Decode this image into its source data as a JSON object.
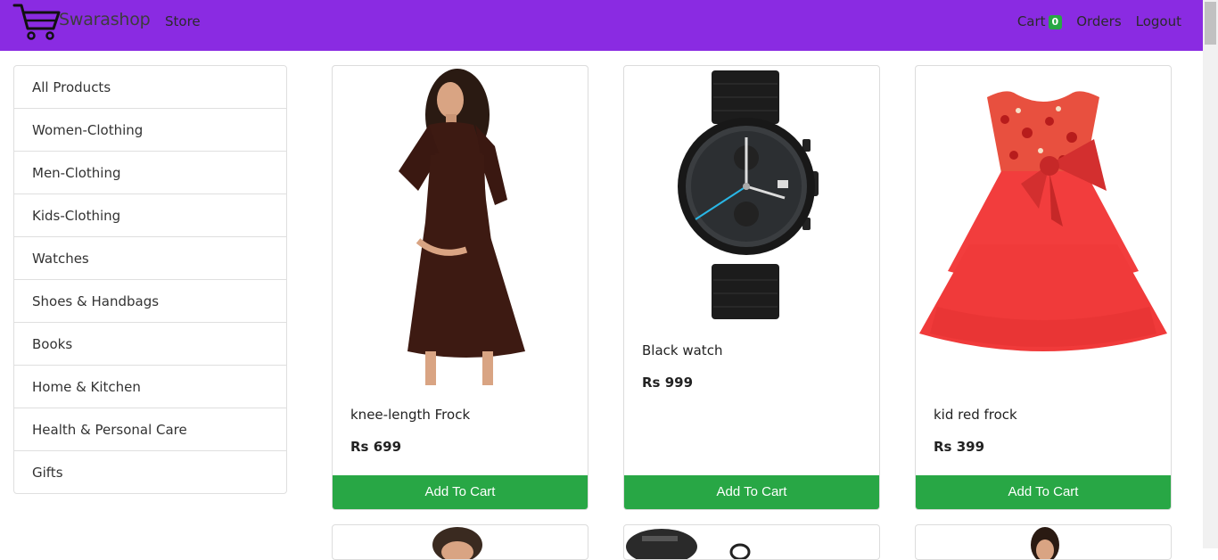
{
  "header": {
    "brand": "Swarashop",
    "store_label": "Store",
    "cart_label": "Cart",
    "cart_count": "0",
    "orders_label": "Orders",
    "logout_label": "Logout"
  },
  "sidebar": {
    "categories": [
      {
        "label": "All Products"
      },
      {
        "label": "Women-Clothing"
      },
      {
        "label": "Men-Clothing"
      },
      {
        "label": "Kids-Clothing"
      },
      {
        "label": "Watches"
      },
      {
        "label": "Shoes & Handbags"
      },
      {
        "label": "Books"
      },
      {
        "label": "Home & Kitchen"
      },
      {
        "label": "Health & Personal Care"
      },
      {
        "label": "Gifts"
      }
    ]
  },
  "products": [
    {
      "name": "knee-length Frock",
      "price": "Rs 699",
      "button": "Add To Cart"
    },
    {
      "name": "Black watch",
      "price": "Rs 999",
      "button": "Add To Cart"
    },
    {
      "name": "kid red frock",
      "price": "Rs 399",
      "button": "Add To Cart"
    }
  ],
  "colors": {
    "navbar": "#8a2be2",
    "button": "#28a745",
    "badge": "#28a745"
  }
}
